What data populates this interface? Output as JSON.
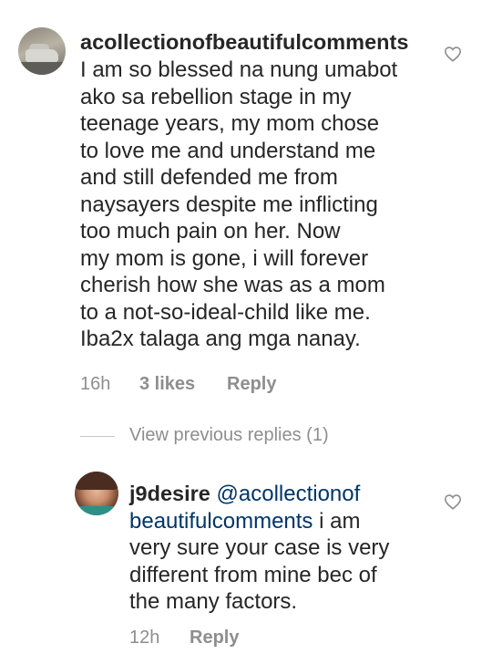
{
  "comment": {
    "username": "acollectionofbeautifulcomments",
    "text_lines": [
      "I am so blessed na nung umabot",
      "ako sa rebellion stage in my",
      "teenage years, my mom chose",
      "to love me and understand me",
      "and still defended me from",
      "naysayers despite me inflicting",
      "too much pain on her. Now",
      "my mom is gone, i will forever",
      "cherish how she was as a mom",
      "to a not-so-ideal-child like me.",
      "Iba2x talaga ang mga nanay."
    ],
    "time": "16h",
    "likes": "3 likes",
    "reply_label": "Reply",
    "like_icon": "heart-outline-icon"
  },
  "view_previous": "View previous replies (1)",
  "reply": {
    "username": "j9desire",
    "mention_line1": "@acollectionof",
    "mention_line2": "beautifulcomments",
    "text_after_mention": " i am",
    "text_lines": [
      "very sure your case is very",
      "different from mine bec of",
      "the many factors."
    ],
    "time": "12h",
    "reply_label": "Reply",
    "like_icon": "heart-outline-icon"
  }
}
